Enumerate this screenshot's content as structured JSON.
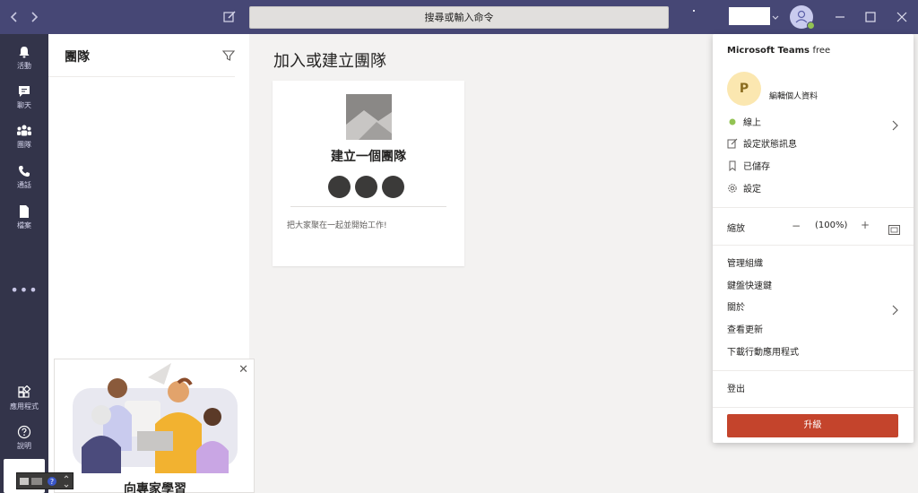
{
  "titlebar": {
    "search_text": "搜尋或輸入命令",
    "icons": {
      "back": "chevron-left-icon",
      "forward": "chevron-right-icon",
      "compose": "compose-icon",
      "minimize": "minimize-icon",
      "maximize": "maximize-icon",
      "close": "close-icon"
    }
  },
  "rail": {
    "items": [
      {
        "label": "活動",
        "icon": "bell-icon"
      },
      {
        "label": "聊天",
        "icon": "chat-icon"
      },
      {
        "label": "團隊",
        "icon": "teams-icon"
      },
      {
        "label": "通話",
        "icon": "phone-icon"
      },
      {
        "label": "檔案",
        "icon": "file-icon"
      }
    ],
    "more": "•••",
    "bottom_items": [
      {
        "label": "應用程式",
        "icon": "apps-icon"
      },
      {
        "label": "說明",
        "icon": "help-icon"
      }
    ]
  },
  "left_panel": {
    "title": "團隊",
    "promo": {
      "title": "向專家學習"
    }
  },
  "main": {
    "title": "加入或建立團隊",
    "card": {
      "title": "建立一個團隊",
      "description": "把大家聚在一起並開始工作!"
    }
  },
  "profile_menu": {
    "app_name": "Microsoft Teams",
    "plan": "free",
    "avatar_initial": "P",
    "edit_profile": "編輯個人資料",
    "status": "線上",
    "set_status_message": "設定狀態訊息",
    "saved": "已儲存",
    "settings": "設定",
    "zoom_label": "縮放",
    "zoom_minus": "−",
    "zoom_value": "(100%)",
    "zoom_plus": "+",
    "manage_org": "管理組織",
    "keyboard_shortcuts": "鍵盤快速鍵",
    "about": "關於",
    "check_updates": "查看更新",
    "download_mobile": "下載行動應用程式",
    "sign_out": "登出",
    "upgrade": "升級"
  },
  "colors": {
    "titlebar": "#464775",
    "rail": "#33344a",
    "accent_upgrade": "#c4442c",
    "presence_available": "#92c353"
  }
}
